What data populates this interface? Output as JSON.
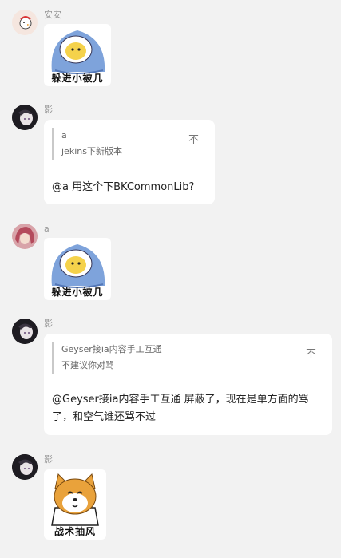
{
  "messages": [
    {
      "sender": "安安",
      "sticker_caption": "躲进小被几"
    },
    {
      "sender": "影",
      "quote_author": "a",
      "quote_text": "jekins下新版本",
      "close": "不",
      "text": "@a 用这个下BKCommonLib?"
    },
    {
      "sender": "a",
      "sticker_caption": "躲进小被几"
    },
    {
      "sender": "影",
      "quote_author": "Geyser接ia内容手工互通",
      "quote_text": "不建议你对骂",
      "close": "不",
      "text": "@Geyser接ia内容手工互通 屏蔽了，现在是单方面的骂了，和空气谁还骂不过"
    },
    {
      "sender": "影",
      "sticker_caption": "战术抽风"
    }
  ],
  "colors": {
    "background": "#f2f2f2",
    "bubble": "#ffffff",
    "name_text": "#999999"
  }
}
